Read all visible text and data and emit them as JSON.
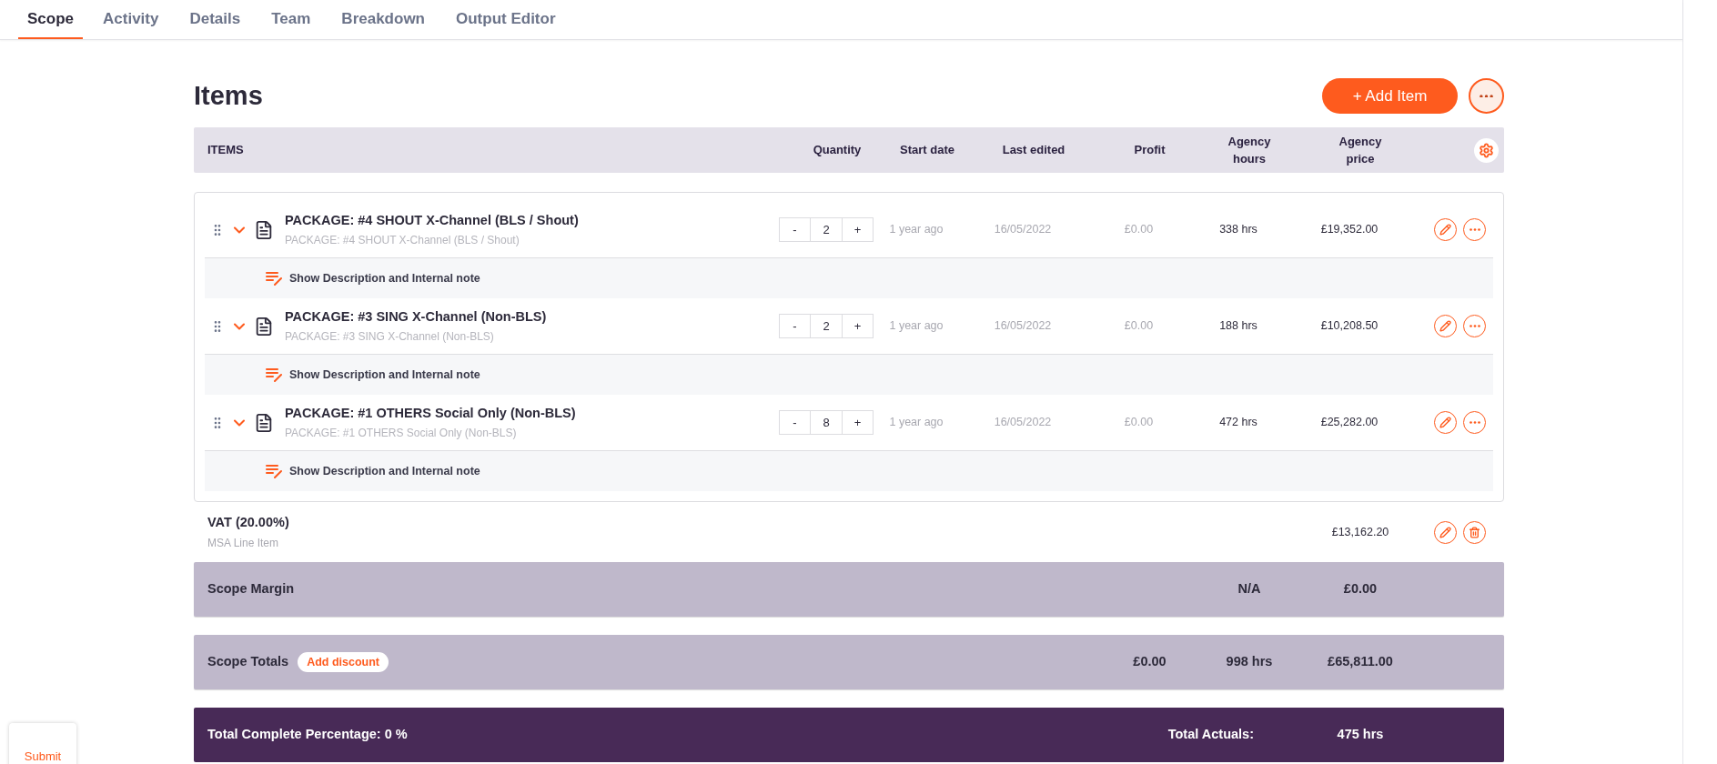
{
  "tabs": [
    {
      "label": "Scope",
      "selected": true
    },
    {
      "label": "Activity",
      "selected": false
    },
    {
      "label": "Details",
      "selected": false
    },
    {
      "label": "Team",
      "selected": false
    },
    {
      "label": "Breakdown",
      "selected": false
    },
    {
      "label": "Output Editor",
      "selected": false
    }
  ],
  "title": "Items",
  "add_button": "+ Add Item",
  "columns": [
    "ITEMS",
    "Quantity",
    "Start date",
    "Last edited",
    "Profit",
    "Agency hours",
    "Agency price"
  ],
  "items": [
    {
      "name": "PACKAGE: #4 SHOUT X-Channel (BLS / Shout)",
      "subtitle": "PACKAGE: #4 SHOUT X-Channel (BLS / Shout)",
      "expanded": true,
      "decrement": "-",
      "quantity": "2",
      "increment": "+",
      "start": "1 year ago",
      "last_edited": "16/05/2022",
      "profit": "£0.00",
      "hours": "338 hrs",
      "price": "£19,352.00",
      "note_link": "Show Description and Internal note"
    },
    {
      "name": "PACKAGE: #3 SING X-Channel (Non-BLS)",
      "subtitle": "PACKAGE: #3 SING X-Channel (Non-BLS)",
      "expanded": true,
      "decrement": "-",
      "quantity": "2",
      "increment": "+",
      "start": "1 year ago",
      "last_edited": "16/05/2022",
      "profit": "£0.00",
      "hours": "188 hrs",
      "price": "£10,208.50",
      "note_link": "Show Description and Internal note"
    },
    {
      "name": "PACKAGE: #1 OTHERS Social Only (Non-BLS)",
      "subtitle": "PACKAGE: #1 OTHERS Social Only (Non-BLS)",
      "expanded": true,
      "decrement": "-",
      "quantity": "8",
      "increment": "+",
      "start": "1 year ago",
      "last_edited": "16/05/2022",
      "profit": "£0.00",
      "hours": "472 hrs",
      "price": "£25,282.00",
      "note_link": "Show Description and Internal note"
    }
  ],
  "vat": {
    "title": "VAT (20.00%)",
    "subtitle": "MSA Line Item",
    "price": "£13,162.20"
  },
  "margin": {
    "label": "Scope Margin",
    "hours": "N/A",
    "price": "£0.00"
  },
  "totals": {
    "label": "Scope Totals",
    "discount_button": "Add discount",
    "profit": "£0.00",
    "hours": "998 hrs",
    "price": "£65,811.00"
  },
  "actuals_bar": {
    "label": "Total Complete Percentage: 0 %",
    "actuals_label": "Total Actuals:",
    "actuals_value": "475 hrs"
  },
  "submit": "Submit"
}
